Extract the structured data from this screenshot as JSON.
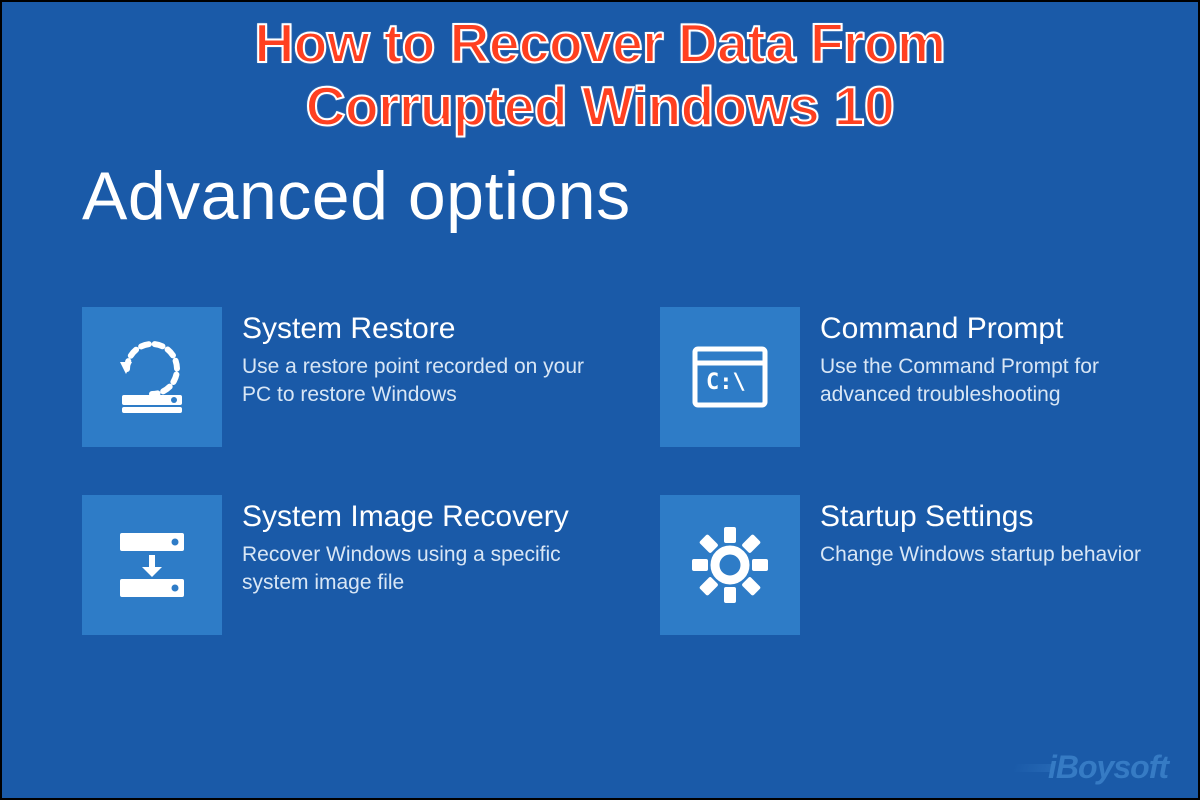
{
  "overlay": {
    "title_line1": "How to Recover Data From",
    "title_line2": "Corrupted Windows 10"
  },
  "page_title": "Advanced options",
  "options": [
    {
      "icon": "system-restore-icon",
      "title": "System Restore",
      "desc": "Use a restore point recorded on your PC to restore Windows"
    },
    {
      "icon": "command-prompt-icon",
      "title": "Command Prompt",
      "desc": "Use the Command Prompt for advanced troubleshooting"
    },
    {
      "icon": "system-image-recovery-icon",
      "title": "System Image Recovery",
      "desc": "Recover Windows using a specific system image file"
    },
    {
      "icon": "startup-settings-icon",
      "title": "Startup Settings",
      "desc": "Change Windows startup behavior"
    }
  ],
  "watermark": "iBoysoft",
  "colors": {
    "background": "#1a5aa8",
    "tile": "#2e7cc7",
    "overlay_text": "#ff4020"
  }
}
